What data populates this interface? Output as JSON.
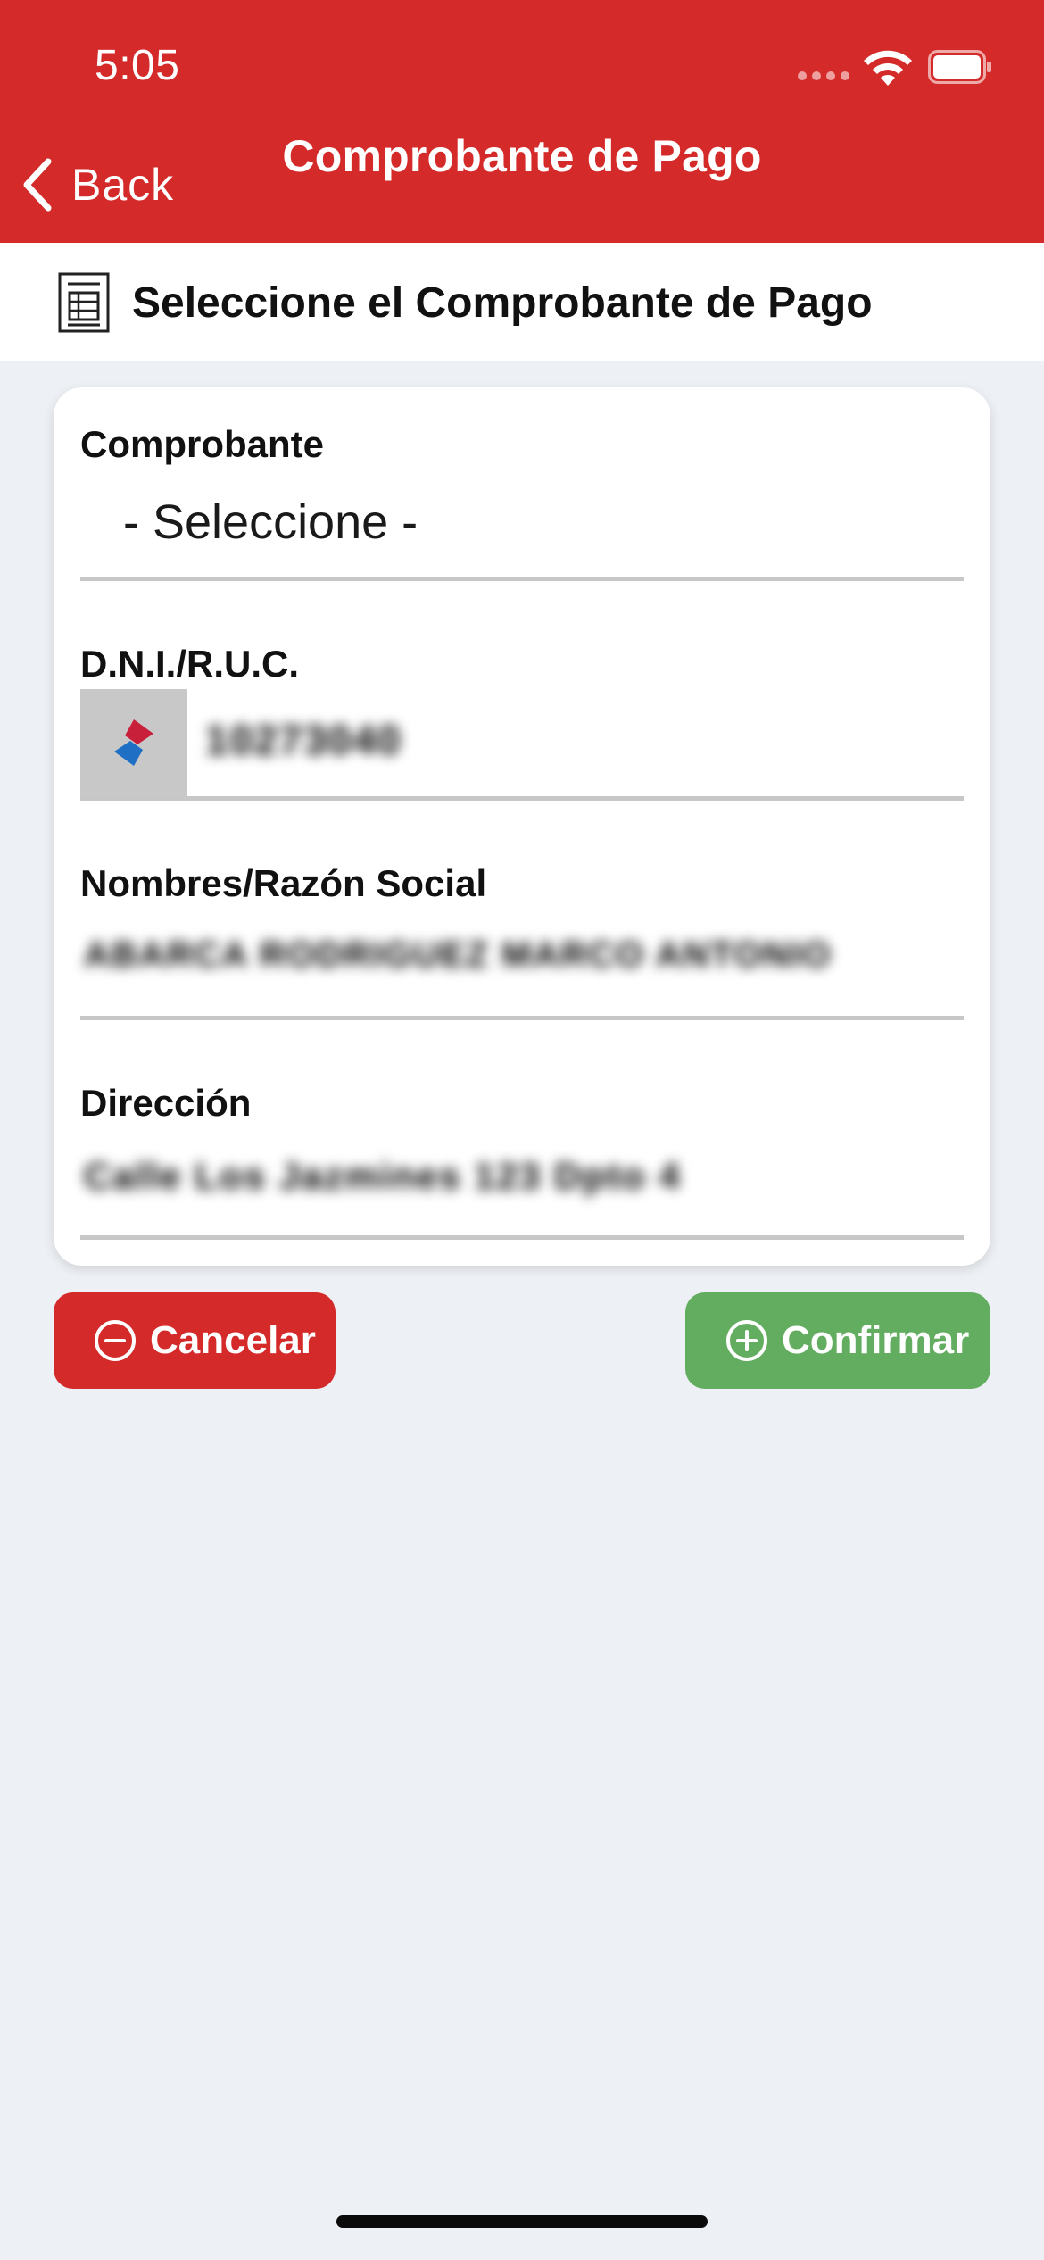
{
  "status_bar": {
    "time": "5:05"
  },
  "nav": {
    "back_label": "Back",
    "title": "Comprobante de Pago"
  },
  "section": {
    "title": "Seleccione el Comprobante de Pago",
    "icon": "receipt-icon"
  },
  "form": {
    "comprobante": {
      "label": "Comprobante",
      "value": "- Seleccione -"
    },
    "dni_ruc": {
      "label": "D.N.I./R.U.C.",
      "value": "10273040",
      "logo": "app-logo-icon"
    },
    "nombres": {
      "label": "Nombres/Razón Social",
      "value": "ABARCA RODRIGUEZ MARCO ANTONIO"
    },
    "direccion": {
      "label": "Dirección",
      "value": "Calle Los Jazmines 123 Dpto 4"
    }
  },
  "buttons": {
    "cancel": {
      "label": "Cancelar",
      "icon": "minus-circle-icon"
    },
    "confirm": {
      "label": "Confirmar",
      "icon": "plus-circle-icon"
    }
  },
  "colors": {
    "brand_red": "#d42a29",
    "confirm_green": "#62ad5f",
    "background": "#edf0f4"
  }
}
